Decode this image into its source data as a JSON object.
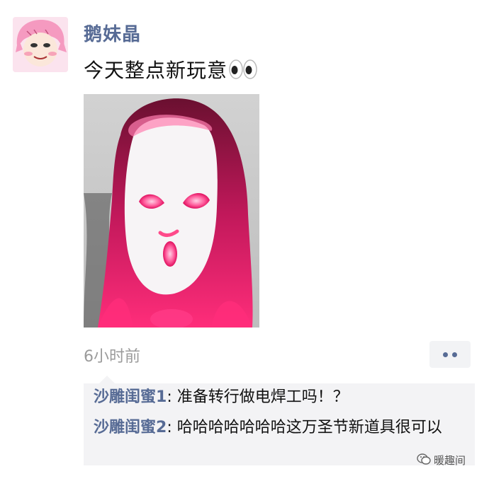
{
  "post": {
    "username": "鹅妹晶",
    "text": "今天整点新玩意",
    "emoji_icon": "eyes-emoji",
    "timestamp": "6小时前",
    "more_icon": "more-dots-icon"
  },
  "comments": [
    {
      "name": "沙雕闺蜜1",
      "sep": ": ",
      "text": "准备转行做电焊工吗！？"
    },
    {
      "name": "沙雕闺蜜2",
      "sep": ": ",
      "text": "哈哈哈哈哈哈哈这万圣节新道具很可以"
    }
  ],
  "watermark": {
    "icon": "wechat-logo",
    "text": "暖趣间"
  },
  "colors": {
    "link": "#576b95",
    "text": "#111111",
    "meta": "#9b9b9b",
    "comment_bg": "#f3f3f5",
    "mask_glow": "#ff2d7a"
  }
}
